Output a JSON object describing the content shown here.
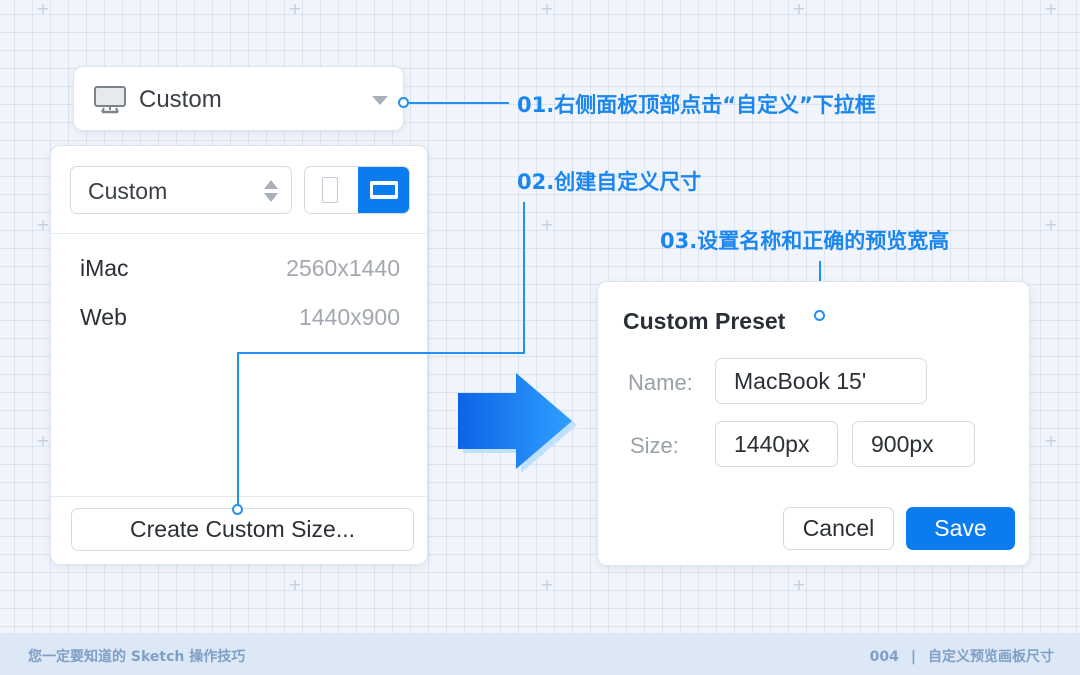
{
  "top_dropdown": {
    "label": "Custom",
    "icon": "monitor-icon"
  },
  "panel": {
    "preset_select": "Custom",
    "orientation": {
      "selected": "landscape"
    },
    "devices": [
      {
        "name": "iMac",
        "size": "2560x1440"
      },
      {
        "name": "Web",
        "size": "1440x900"
      }
    ],
    "create_button": "Create Custom Size..."
  },
  "preset_dialog": {
    "title": "Custom Preset",
    "name_label": "Name:",
    "name_value": "MacBook 15'",
    "size_label": "Size:",
    "width_value": "1440px",
    "height_value": "900px",
    "cancel_label": "Cancel",
    "save_label": "Save"
  },
  "annotations": {
    "step1": "01.右侧面板顶部点击“自定义”下拉框",
    "step2": "02.创建自定义尺寸",
    "step3": "03.设置名称和正确的预览宽高"
  },
  "footer": {
    "left": "您一定要知道的 Sketch 操作技巧",
    "number": "004",
    "separator": "|",
    "title": "自定义预览画板尺寸"
  },
  "colors": {
    "accent": "#0a7cf0",
    "annotation": "#1a86f0",
    "footer_bg": "#dde8f7"
  }
}
